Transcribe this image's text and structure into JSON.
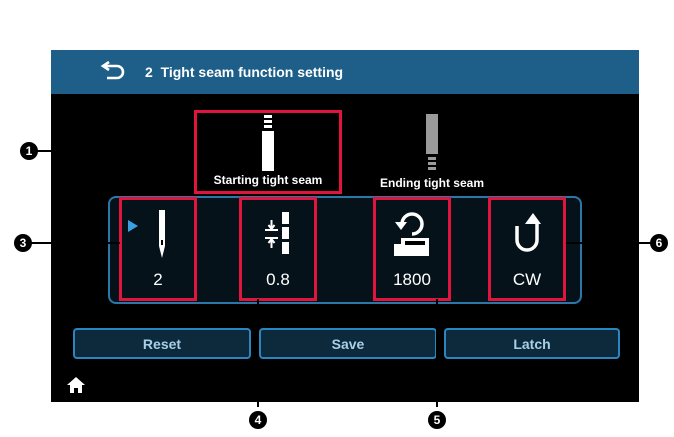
{
  "header": {
    "back_icon": "back-arrow-icon",
    "title": "2  Tight seam function setting"
  },
  "seam_tabs": [
    {
      "label": "Starting tight seam",
      "selected": true
    },
    {
      "label": "Ending tight seam",
      "selected": false
    }
  ],
  "params": [
    {
      "icon": "needle-stitch-count-icon",
      "value": "2",
      "selected_marker": true
    },
    {
      "icon": "stitch-pitch-icon",
      "value": "0.8"
    },
    {
      "icon": "sewing-speed-icon",
      "value": "1800"
    },
    {
      "icon": "rotation-direction-icon",
      "value": "CW"
    }
  ],
  "buttons": {
    "reset": "Reset",
    "save": "Save",
    "latch": "Latch"
  },
  "footer": {
    "home_icon": "home-icon"
  },
  "callouts": {
    "c1": "1",
    "c3": "3",
    "c4": "4",
    "c5": "5",
    "c6": "6"
  },
  "colors": {
    "titlebar": "#1d5f88",
    "highlight": "#e0143c",
    "button_border": "#2b86c0",
    "marker": "#3aa0e0"
  }
}
